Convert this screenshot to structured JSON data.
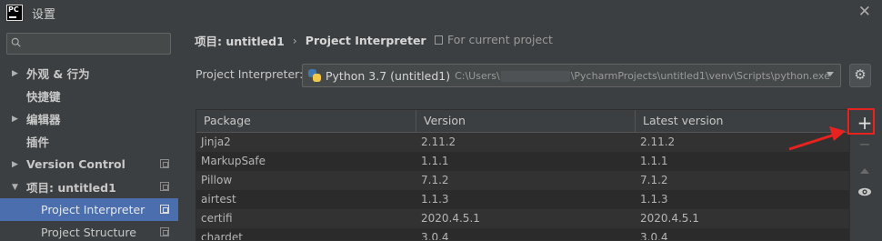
{
  "window": {
    "title": "设置"
  },
  "sidebar": {
    "search_placeholder": "",
    "items": [
      {
        "label": "外观 & 行为",
        "expandable": true
      },
      {
        "label": "快捷键",
        "expandable": false
      },
      {
        "label": "编辑器",
        "expandable": true
      },
      {
        "label": "插件",
        "expandable": false
      },
      {
        "label": "Version Control",
        "expandable": true
      },
      {
        "label": "项目: untitled1",
        "expandable": true,
        "expanded": true
      },
      {
        "label": "Project Interpreter",
        "selected": true
      },
      {
        "label": "Project Structure"
      }
    ]
  },
  "breadcrumb": {
    "project": "项目: untitled1",
    "separator": "›",
    "page": "Project Interpreter"
  },
  "scope_note": "For current project",
  "interpreter": {
    "label": "Project Interpreter:",
    "name": "Python 3.7 (untitled1)",
    "path_prefix": "C:\\Users\\",
    "path_suffix": "\\PycharmProjects\\untitled1\\venv\\Scripts\\python.exe"
  },
  "table": {
    "columns": [
      "Package",
      "Version",
      "Latest version"
    ],
    "rows": [
      [
        "Jinja2",
        "2.11.2",
        "2.11.2"
      ],
      [
        "MarkupSafe",
        "1.1.1",
        "1.1.1"
      ],
      [
        "Pillow",
        "7.1.2",
        "7.1.2"
      ],
      [
        "airtest",
        "1.1.3",
        "1.1.3"
      ],
      [
        "certifi",
        "2020.4.5.1",
        "2020.4.5.1"
      ],
      [
        "chardet",
        "3.0.4",
        "3.0.4"
      ]
    ]
  },
  "toolbar": {
    "add_label": "+",
    "remove_label": "−"
  },
  "colors": {
    "selection": "#4b6eaf",
    "highlight_box": "#e8231f",
    "background": "#3c3f41",
    "table_bg": "#2b2b2b"
  }
}
